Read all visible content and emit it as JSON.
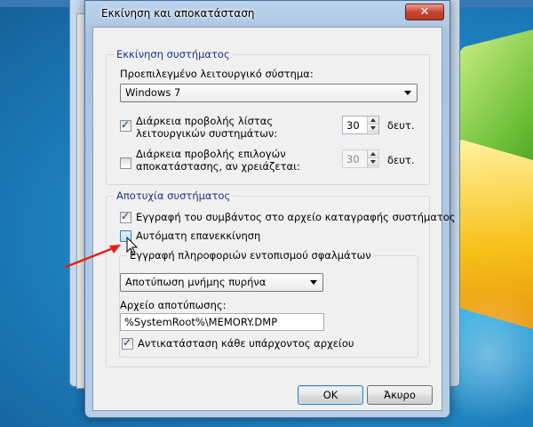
{
  "dialog": {
    "title": "Εκκίνηση και αποκατάσταση",
    "close_label": "✕"
  },
  "startup": {
    "group_label": "Εκκίνηση συστήματος",
    "default_os_label": "Προεπιλεγμένο λειτουργικό σύστημα:",
    "default_os_value": "Windows 7",
    "os_list_label": "Διάρκεια προβολής λίστας λειτουργικών συστημάτων:",
    "os_list_checked": true,
    "os_list_seconds": "30",
    "os_list_unit": "δευτ.",
    "recovery_label": "Διάρκεια προβολής επιλογών αποκατάστασης, αν χρειάζεται:",
    "recovery_checked": false,
    "recovery_seconds": "30",
    "recovery_unit": "δευτ."
  },
  "failure": {
    "group_label": "Αποτυχία συστήματος",
    "write_event_label": "Εγγραφή του συμβάντος στο αρχείο καταγραφής συστήματος",
    "write_event_checked": true,
    "auto_restart_label": "Αυτόματη επανεκκίνηση",
    "auto_restart_checked": false,
    "debug": {
      "group_label": "Εγγραφή πληροφοριών εντοπισμού σφαλμάτων",
      "dump_type_value": "Αποτύπωση μνήμης πυρήνα",
      "dump_file_label": "Αρχείο αποτύπωσης:",
      "dump_file_value": "%SystemRoot%\\MEMORY.DMP",
      "overwrite_label": "Αντικατάσταση κάθε υπάρχοντος αρχείου",
      "overwrite_checked": true
    }
  },
  "buttons": {
    "ok": "OK",
    "cancel": "Άκυρο"
  },
  "colors": {
    "group_label": "#1e3287",
    "annotation_arrow": "#e0211b"
  }
}
